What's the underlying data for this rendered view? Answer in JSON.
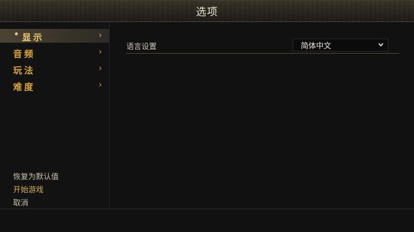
{
  "header": {
    "title": "选项"
  },
  "sidebar": {
    "items": [
      {
        "label": "显示",
        "active": true,
        "icon": "diamond-bullet-icon",
        "chevron": "›"
      },
      {
        "label": "音频",
        "active": false,
        "chevron": "›"
      },
      {
        "label": "玩法",
        "active": false,
        "chevron": "›"
      },
      {
        "label": "难度",
        "active": false,
        "chevron": "›"
      }
    ],
    "actions": {
      "reset": "恢复为默认值",
      "start": "开始游戏",
      "cancel": "取消"
    }
  },
  "main": {
    "settings": [
      {
        "label": "语言设置",
        "value": "简体中文",
        "control": "dropdown"
      }
    ]
  },
  "colors": {
    "accent_gold": "#d8a33a",
    "active_gold": "#e9c977",
    "background": "#111111"
  }
}
